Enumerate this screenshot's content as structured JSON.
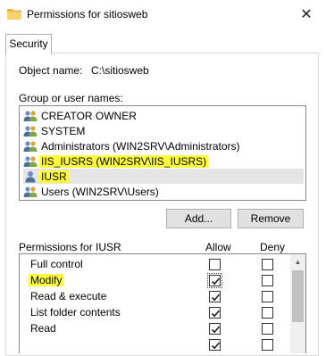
{
  "window": {
    "title": "Permissions for sitiosweb",
    "close_glyph": "✕"
  },
  "tabs": [
    {
      "label": "Security"
    }
  ],
  "object": {
    "label": "Object name:",
    "value": "C:\\sitiosweb"
  },
  "groups": {
    "label": "Group or user names:",
    "items": [
      {
        "label": "CREATOR OWNER",
        "icon": "users-icon"
      },
      {
        "label": "SYSTEM",
        "icon": "users-icon"
      },
      {
        "label": "Administrators (WIN2SRV\\Administrators)",
        "icon": "users-icon"
      },
      {
        "label": "IIS_IUSRS (WIN2SRV\\IIS_IUSRS)",
        "icon": "users-icon",
        "highlighted": true
      },
      {
        "label": "IUSR",
        "icon": "user-icon",
        "selected": true,
        "highlighted": true
      },
      {
        "label": "Users (WIN2SRV\\Users)",
        "icon": "users-icon"
      }
    ]
  },
  "buttons": {
    "add": "Add...",
    "remove": "Remove"
  },
  "permissions": {
    "label": "Permissions for IUSR",
    "allow_header": "Allow",
    "deny_header": "Deny",
    "rows": [
      {
        "name": "Full control",
        "allow": false,
        "deny": false
      },
      {
        "name": "Modify",
        "allow": true,
        "deny": false,
        "highlighted": true
      },
      {
        "name": "Read & execute",
        "allow": true,
        "deny": false
      },
      {
        "name": "List folder contents",
        "allow": true,
        "deny": false
      },
      {
        "name": "Read",
        "allow": true,
        "deny": false
      },
      {
        "name": "",
        "allow": true,
        "deny": false
      }
    ]
  },
  "colors": {
    "highlight": "#ffff3b",
    "selection": "#e5e5e5"
  }
}
